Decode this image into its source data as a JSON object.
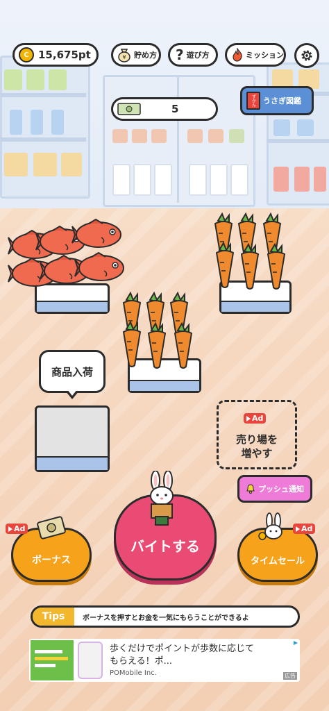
{
  "top_bar": {
    "points": "15,675pt",
    "coin_symbol": "C",
    "savings_label": "貯め方",
    "howto_label": "遊び方",
    "howto_symbol": "?",
    "mission_label": "ミッション"
  },
  "money_counter": {
    "value": "5"
  },
  "encyclopedia_button": {
    "label": "うさぎ図鑑",
    "book_label": "ずかん"
  },
  "stock_bubble": {
    "label": "商品入荷"
  },
  "expand_store": {
    "ad_label": "Ad",
    "label_line1": "売り場を",
    "label_line2": "増やす"
  },
  "push_notification": {
    "label": "プッシュ通知"
  },
  "bonus_button": {
    "label": "ボーナス",
    "ad_label": "Ad"
  },
  "work_button": {
    "label": "バイトする"
  },
  "timesale_button": {
    "label": "タイムセール",
    "ad_label": "Ad"
  },
  "tips": {
    "tag": "Tips",
    "text": "ボーナスを押すとお金を一気にもらうことができるよ"
  },
  "ad_banner": {
    "line1": "歩くだけでポイントが歩数に応じて",
    "line2": "もらえる！ポ...",
    "advertiser": "POMobile Inc.",
    "tag": "広告"
  },
  "colors": {
    "work_button": "#e94b75",
    "bonus_button": "#f7a21b",
    "push_button": "#ef7bd9",
    "tips_tag": "#f3b72d",
    "ad_badge": "#e8453c"
  }
}
